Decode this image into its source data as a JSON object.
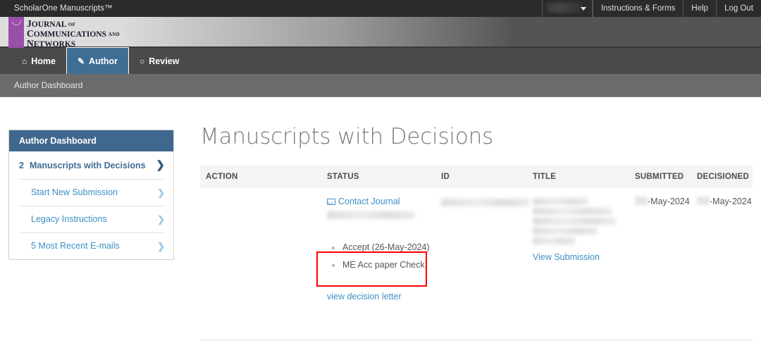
{
  "topbar": {
    "brand": "ScholarOne Manuscripts™",
    "user_redacted": true,
    "nav": [
      {
        "label": "Instructions & Forms"
      },
      {
        "label": "Help"
      },
      {
        "label": "Log Out"
      }
    ]
  },
  "journal": {
    "line1_cap": "J",
    "line1_rest": "OURNAL",
    "line1_small": "OF",
    "line2_cap": "C",
    "line2_rest": "OMMUNICATIONS",
    "line2_small": "AND",
    "line3_cap": "N",
    "line3_rest": "ETWORKS",
    "accent_color": "#9a4fa8"
  },
  "tabs": [
    {
      "label": "Home",
      "icon": "home-icon",
      "glyph": "⌂",
      "active": false
    },
    {
      "label": "Author",
      "icon": "pencil-icon",
      "glyph": "✎",
      "active": true
    },
    {
      "label": "Review",
      "icon": "comment-icon",
      "glyph": "○",
      "active": false
    }
  ],
  "breadcrumb": {
    "label": "Author Dashboard"
  },
  "sidebar": {
    "header": "Author Dashboard",
    "items": [
      {
        "count": "2",
        "label": "Manuscripts with Decisions",
        "sub": false,
        "arrow": "❯"
      },
      {
        "count": "",
        "label": "Start New Submission",
        "sub": true,
        "arrow": "❯"
      },
      {
        "count": "",
        "label": "Legacy Instructions",
        "sub": true,
        "arrow": "❯"
      },
      {
        "count": "",
        "label": "5 Most Recent E-mails",
        "sub": true,
        "arrow": "❯"
      }
    ]
  },
  "main": {
    "title": "Manuscripts with Decisions",
    "columns": [
      "ACTION",
      "STATUS",
      "ID",
      "TITLE",
      "SUBMITTED",
      "DECISIONED"
    ],
    "row": {
      "action": "",
      "status": {
        "contact_journal": "Contact Journal",
        "contact_icon": "envelope-icon",
        "redacted_line": true,
        "decision_bullets": [
          "Accept (26-May-2024)",
          "ME Acc paper Check"
        ],
        "view_decision_letter": "view decision letter"
      },
      "id_redacted": true,
      "title_redacted": true,
      "view_submission": "View Submission",
      "submitted": "-May-2024",
      "decisioned": "-May-2024"
    },
    "highlight": {
      "color": "#ff0000",
      "target": "Accept (26-May-2024)"
    }
  }
}
